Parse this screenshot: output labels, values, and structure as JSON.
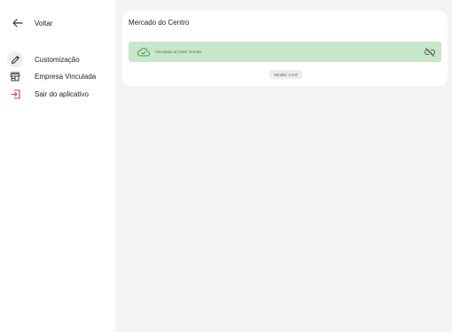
{
  "sidebar": {
    "back": {
      "label": "Voltar",
      "icon": "arrow-left-icon"
    },
    "items": [
      {
        "label": "Customização",
        "icon": "pencil-icon",
        "active": true
      },
      {
        "label": "Empresa Vinculada",
        "icon": "store-icon",
        "active": false
      },
      {
        "label": "Sair do aplicativo",
        "icon": "logout-icon",
        "color": "#e53935",
        "active": false
      }
    ]
  },
  "main": {
    "title": "Mercado do Centro",
    "link_status": {
      "text": "Vinculado ao Navi Vendas",
      "icon": "cloud-check-icon",
      "action_icon": "unlink-icon",
      "background": "#c8e6c9",
      "accent": "#43a047"
    },
    "version": "Versão: 1.0.0"
  }
}
